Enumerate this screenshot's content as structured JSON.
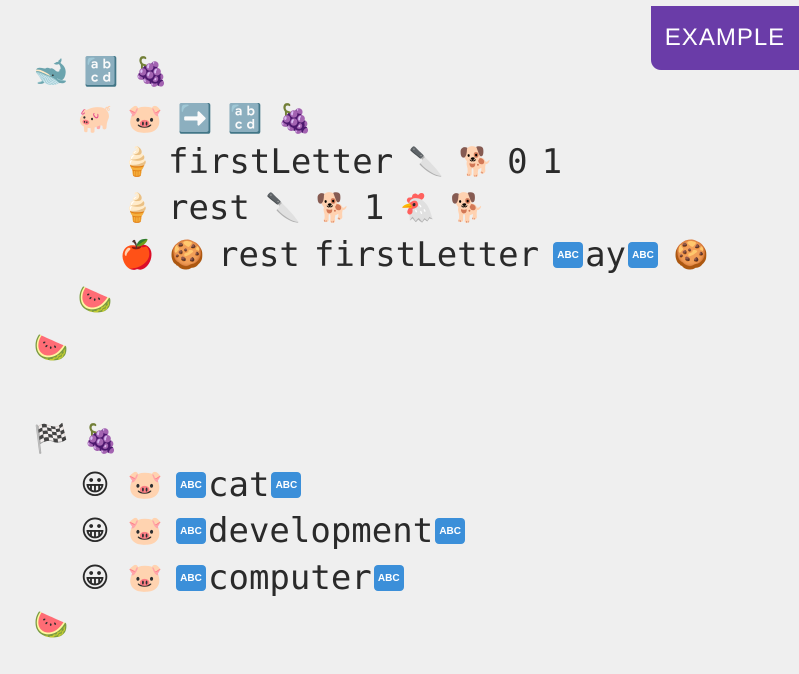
{
  "badge": "EXAMPLE",
  "icons": {
    "whale": "🐋",
    "abcd": "🔡",
    "grapes": "🍇",
    "pig": "🐖",
    "pig_face": "🐷",
    "arrow_right": "➡️",
    "ice_cream": "🍦",
    "knife": "🔪",
    "dog": "🐕",
    "chicken": "🐔",
    "apple": "🍎",
    "cookie": "🍪",
    "watermelon": "🍉",
    "checkered_flag": "🏁",
    "grinning_face": "😀"
  },
  "string_marker": "ABC",
  "code": {
    "line3": {
      "var": "firstLetter",
      "n1": "0",
      "n2": "1"
    },
    "line4": {
      "var": "rest",
      "n1": "1"
    },
    "line5": {
      "a": "rest",
      "b": "firstLetter",
      "str": "ay"
    },
    "calls": [
      "cat",
      "development",
      "computer"
    ]
  }
}
